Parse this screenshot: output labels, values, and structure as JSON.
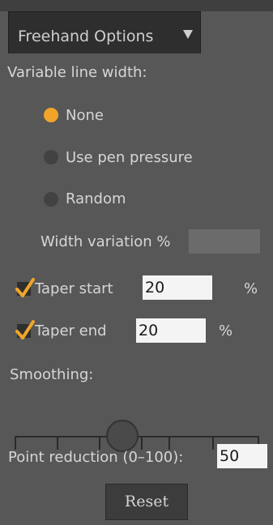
{
  "panel": {
    "tab_title": "Freehand Options",
    "variable_width_label": "Variable line width:",
    "radio_options": [
      {
        "label": "None",
        "selected": true
      },
      {
        "label": "Use pen pressure",
        "selected": false
      },
      {
        "label": "Random",
        "selected": false
      }
    ],
    "width_variation_label": "Width variation %",
    "width_variation_value": "",
    "taper_start": {
      "label": "Taper start",
      "checked": true,
      "value": "20",
      "unit": "%"
    },
    "taper_end": {
      "label": "Taper end",
      "checked": true,
      "value": "20",
      "unit": "%"
    },
    "smoothing_label": "Smoothing:",
    "smoothing_level": 0.44,
    "point_reduction_label": "Point reduction (0–100):",
    "point_reduction_value": "50",
    "reset_label": "Reset"
  },
  "colors": {
    "accent": "#f0a52a",
    "panel_bg": "#575757",
    "tab_bg": "#2e2e2e"
  }
}
